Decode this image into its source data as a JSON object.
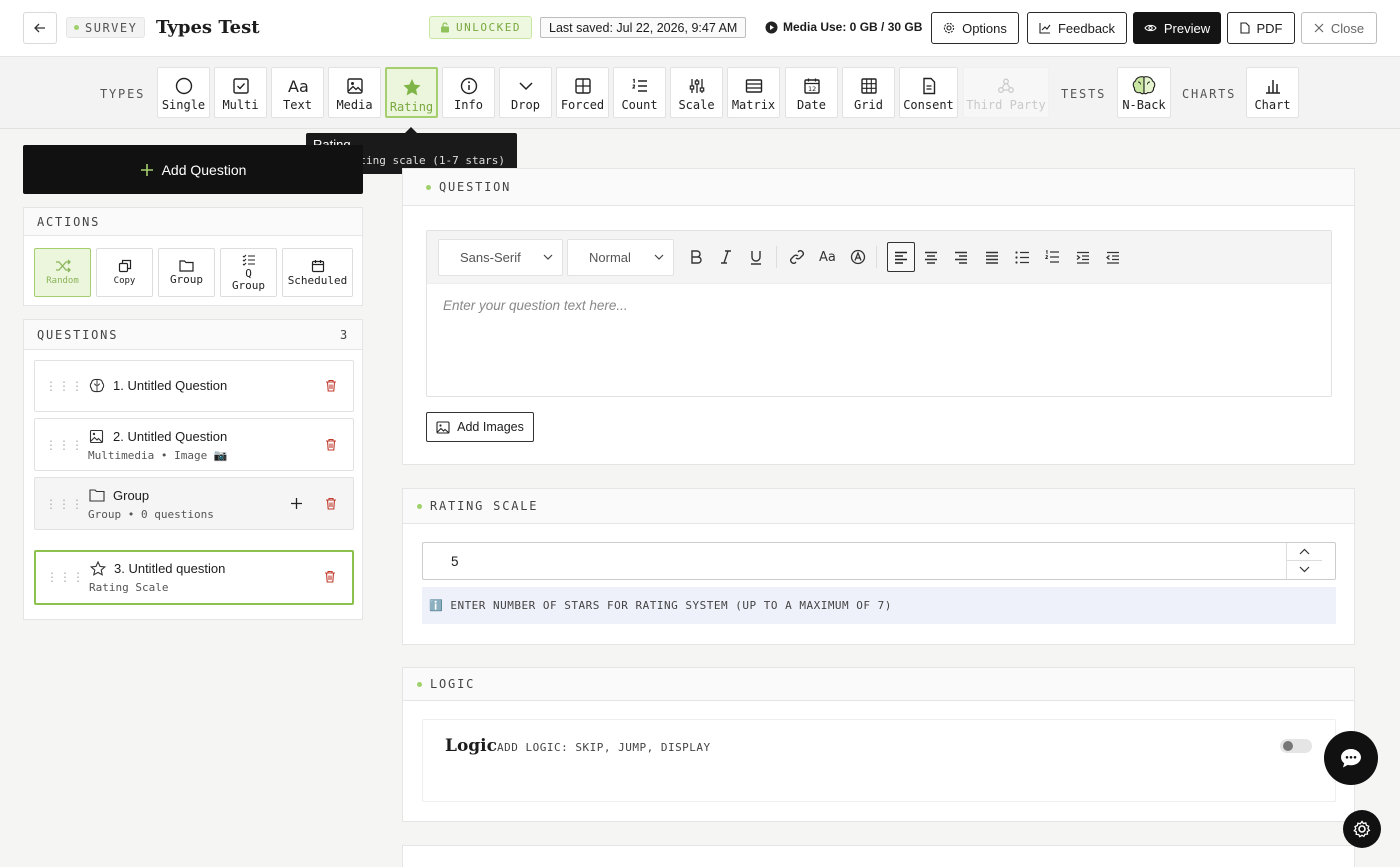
{
  "header": {
    "survey_badge": "SURVEY",
    "title": "Types Test",
    "lock_status": "UNLOCKED",
    "last_saved": "Last saved: Jul 22, 2026, 9:47 AM",
    "media_use": "Media Use: 0 GB / 30 GB",
    "buttons": {
      "options": "Options",
      "feedback": "Feedback",
      "preview": "Preview",
      "pdf": "PDF",
      "close": "Close"
    }
  },
  "types_bar": {
    "types_label": "TYPES",
    "tests_label": "TESTS",
    "charts_label": "CHARTS",
    "types": [
      {
        "label": "Single",
        "icon": "circle-icon"
      },
      {
        "label": "Multi",
        "icon": "checkbox-icon"
      },
      {
        "label": "Text",
        "icon": "text-aa-icon"
      },
      {
        "label": "Media",
        "icon": "image-icon"
      },
      {
        "label": "Rating",
        "icon": "star-icon",
        "active": true
      },
      {
        "label": "Info",
        "icon": "info-icon"
      },
      {
        "label": "Drop",
        "icon": "chevron-down-icon"
      },
      {
        "label": "Forced",
        "icon": "grid-2x2-icon"
      },
      {
        "label": "Count",
        "icon": "numbered-list-icon"
      },
      {
        "label": "Scale",
        "icon": "sliders-icon"
      },
      {
        "label": "Matrix",
        "icon": "table-icon"
      },
      {
        "label": "Date",
        "icon": "calendar-icon"
      },
      {
        "label": "Grid",
        "icon": "grid-3x3-icon"
      },
      {
        "label": "Consent",
        "icon": "document-icon"
      },
      {
        "label": "Third Party",
        "icon": "webhook-icon",
        "disabled": true
      }
    ],
    "tests": [
      {
        "label": "N-Back",
        "icon": "brain-icon"
      }
    ],
    "charts": [
      {
        "label": "Chart",
        "icon": "bar-chart-icon"
      }
    ],
    "tooltip": {
      "title": "Rating",
      "description": "Star rating scale (1-7 stars)"
    }
  },
  "sidebar": {
    "add_question": "Add Question",
    "actions_title": "ACTIONS",
    "actions": [
      {
        "label": "Random",
        "icon": "shuffle-icon"
      },
      {
        "label": "Copy",
        "icon": "copy-icon"
      },
      {
        "label": "Group",
        "icon": "folder-icon"
      },
      {
        "label": "Q\nGroup",
        "icon": "checklist-icon"
      },
      {
        "label": "Scheduled",
        "icon": "calendar-icon"
      }
    ],
    "questions_title": "QUESTIONS",
    "questions_count": "3",
    "questions": [
      {
        "title": "1. Untitled Question",
        "subtitle": "",
        "icon": "brain-icon"
      },
      {
        "title": "2. Untitled Question",
        "subtitle": "Multimedia • Image 📷",
        "icon": "image-icon"
      },
      {
        "title": "Group",
        "subtitle": "Group • 0 questions",
        "icon": "folder-icon"
      },
      {
        "title": "3. Untitled question",
        "subtitle": "Rating Scale",
        "icon": "star-icon",
        "selected": true
      }
    ]
  },
  "main": {
    "question_section": {
      "title": "QUESTION",
      "font_select": "Sans-Serif",
      "size_select": "Normal",
      "placeholder": "Enter your question text here...",
      "add_images": "Add Images"
    },
    "rating_section": {
      "title": "RATING SCALE",
      "stars_value": "5",
      "info_text": "ℹ️ ENTER NUMBER OF STARS FOR RATING SYSTEM (UP TO A MAXIMUM OF 7)"
    },
    "logic_section": {
      "title": "LOGIC",
      "heading": "Logic",
      "description": "ADD LOGIC: SKIP, JUMP, DISPLAY",
      "enabled": false
    }
  },
  "colors": {
    "accent_green": "#9fd16a",
    "dark": "#111111",
    "trash_red": "#c0392b"
  }
}
